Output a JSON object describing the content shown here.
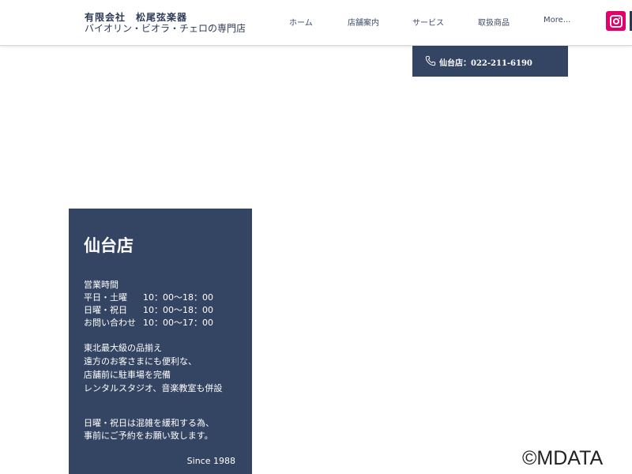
{
  "header": {
    "brand_name": "有限会社　松尾弦楽器",
    "brand_tagline": "バイオリン・ビオラ・チェロの専門店",
    "nav": [
      {
        "label": "ホーム"
      },
      {
        "label": "店舗案内"
      },
      {
        "label": "サービス"
      },
      {
        "label": "取扱商品"
      },
      {
        "label": "More..."
      }
    ],
    "social_icon": "instagram-icon",
    "social_color": "#e4006b"
  },
  "phone": {
    "icon": "phone-icon",
    "text": "仙台店：022-211-6190"
  },
  "store": {
    "title": "仙台店",
    "hours_heading": "営業時間",
    "hours": [
      {
        "day": "平日・土曜",
        "time": "10：00〜18：00"
      },
      {
        "day": "日曜・祝日",
        "time": "10：00〜18：00"
      },
      {
        "day": "お問い合わせ",
        "time": "10：00〜17：00"
      }
    ],
    "features": [
      "東北最大級の品揃え",
      "遠方のお客さまにも便利な、",
      "店舗前に駐車場を完備",
      "レンタルスタジオ、音楽教室も併設"
    ],
    "notice": [
      "日曜・祝日は混雑を緩和する為、",
      "事前にご予約をお願い致します。"
    ],
    "since": "Since 1988"
  },
  "watermark": "©MDATA",
  "colors": {
    "panel": "#344563",
    "brand_text": "#2c3a55",
    "nav_text": "#3d4a66"
  }
}
